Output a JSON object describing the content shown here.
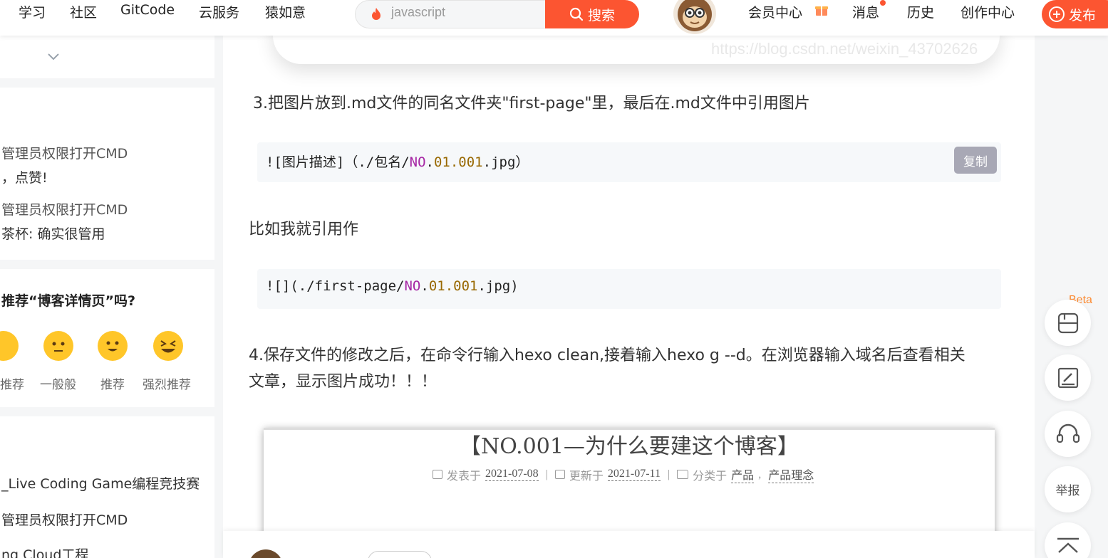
{
  "nav": {
    "links": [
      "学习",
      "社区",
      "GitCode",
      "云服务",
      "猿如意"
    ],
    "search_query": "javascript",
    "search_button": "搜索",
    "right_links": [
      "会员中心",
      "消息",
      "历史",
      "创作中心"
    ],
    "publish": "发布"
  },
  "left": {
    "comments": [
      "管理员权限打开CMD",
      "，点赞!",
      "管理员权限打开CMD",
      "茶杯: 确实很管用"
    ],
    "survey_title": "推荐“博客详情页”吗?",
    "survey_options": [
      "推荐",
      "一般般",
      "推荐",
      "强烈推荐"
    ],
    "recent_posts": [
      "_Live Coding Game编程竞技赛",
      "管理员权限打开CMD",
      "ng Cloud工程"
    ]
  },
  "article": {
    "watermark": "https://blog.csdn.net/weixin_43702626",
    "step3": "3.把图片放到.md文件的同名文件夹\"first-page\"里，最后在.md文件中引用图片",
    "code1": {
      "prefix": "![图片描述]（./包名/",
      "kw": "NO",
      "dot": ".",
      "num": "01.001",
      "suffix": ".jpg）"
    },
    "copy": "复制",
    "example": "比如我就引用作",
    "code2": {
      "prefix": "![](./first-page/",
      "kw": "NO",
      "dot": ".",
      "num": "01.001",
      "suffix": ".jpg)"
    },
    "step4_line1": "4.保存文件的修改之后，在命令行输入hexo clean,接着输入hexo g --d。在浏览器输入域名后查看相关",
    "step4_line2": "文章，显示图片成功！！！",
    "screenshot": {
      "title": "【NO.001—为什么要建这个博客】",
      "posted_label": "发表于",
      "posted_date": "2021-07-08",
      "updated_label": "更新于",
      "updated_date": "2021-07-11",
      "category_label": "分类于",
      "category1": "产品",
      "category2": "产品理念"
    }
  },
  "tools": {
    "beta": "Beta",
    "report": "举报"
  },
  "colors": {
    "accent": "#fc5531",
    "code_bg": "#f6f8fa",
    "keyword": "#a626a4",
    "number": "#986801"
  }
}
